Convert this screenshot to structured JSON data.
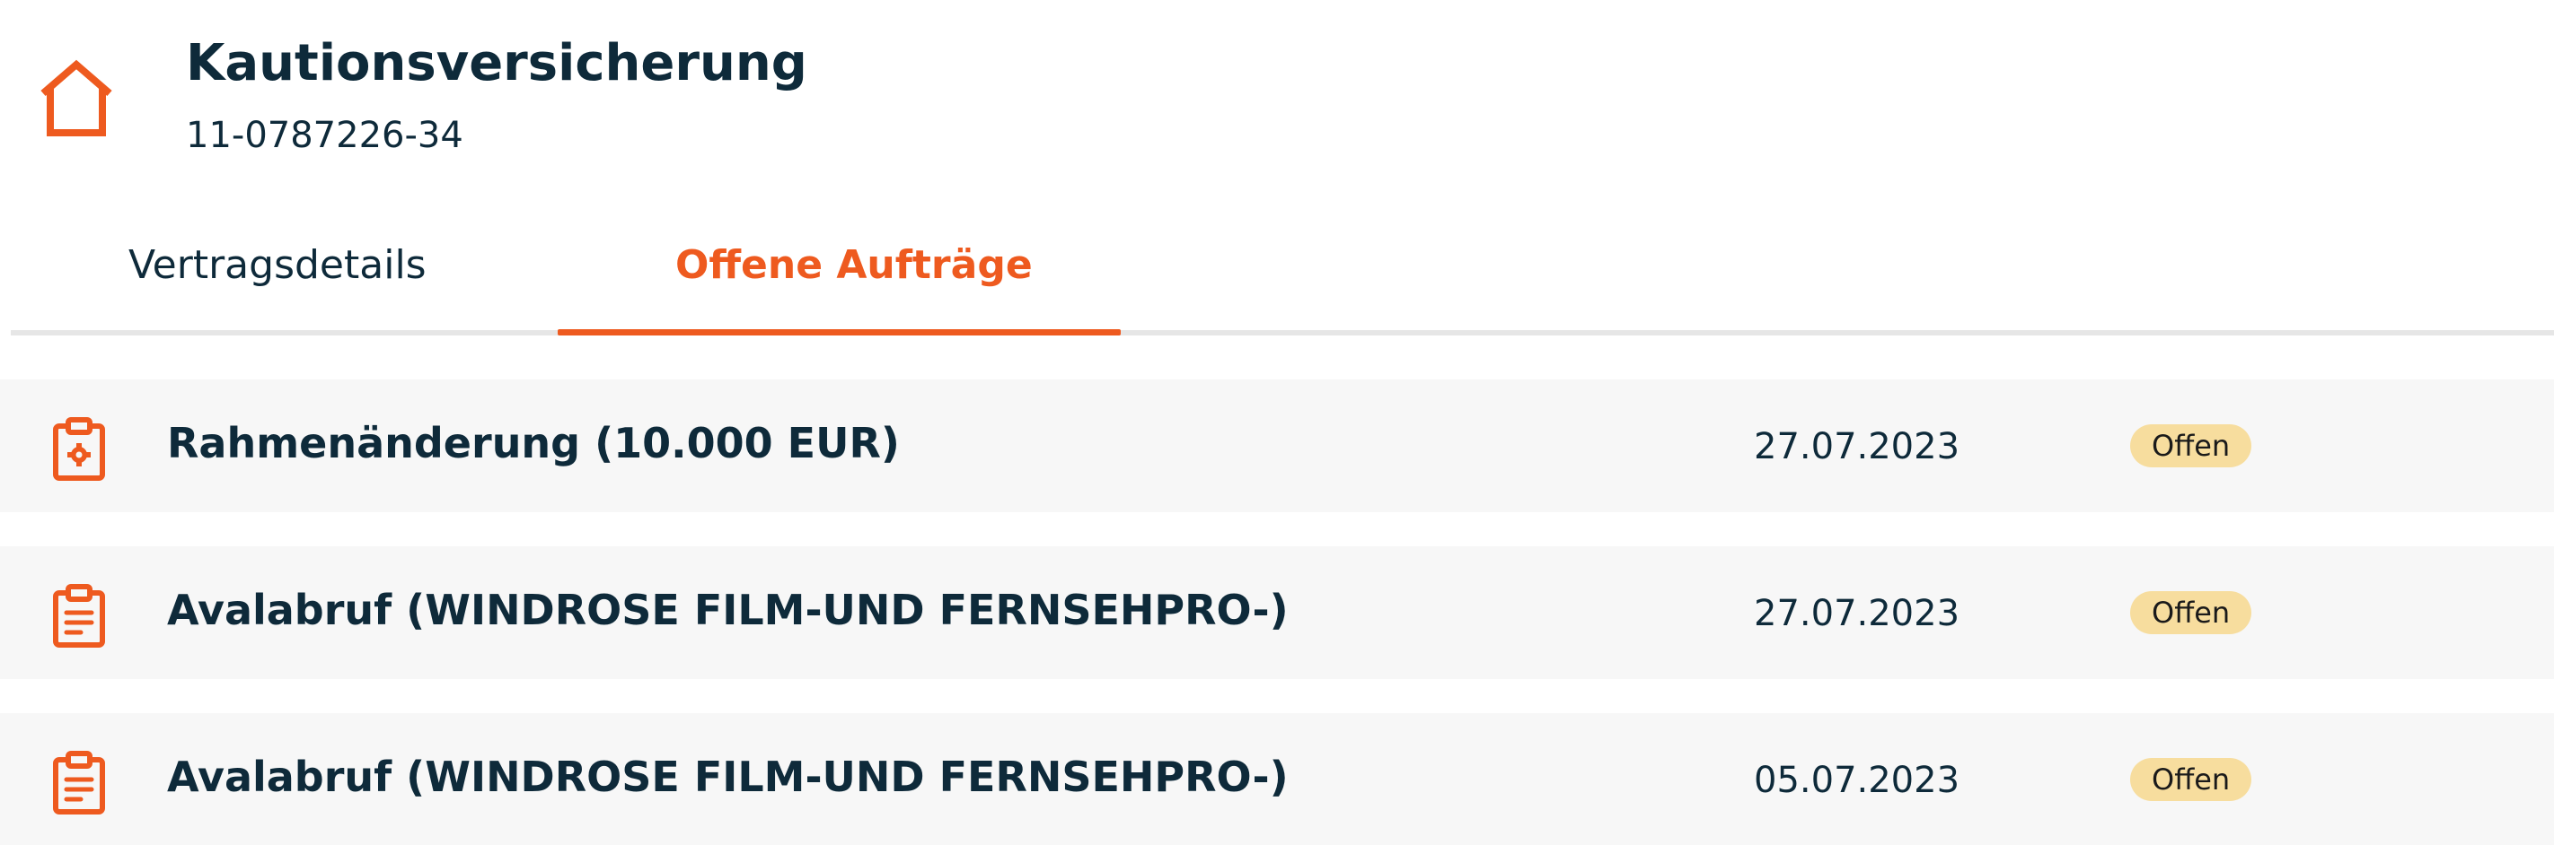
{
  "header": {
    "icon": "house-icon",
    "title": "Kautionsversicherung",
    "contract_number": "11-0787226-34"
  },
  "tabs": [
    {
      "label": "Vertragsdetails",
      "active": false
    },
    {
      "label": "Offene Aufträge",
      "active": true
    }
  ],
  "orders": [
    {
      "icon": "clipboard-gear-icon",
      "title": "Rahmenänderung (10.000 EUR)",
      "date": "27.07.2023",
      "status": "Offen"
    },
    {
      "icon": "clipboard-list-icon",
      "title": "Avalabruf (WINDROSE FILM-UND FERNSEHPRO-)",
      "date": "27.07.2023",
      "status": "Offen"
    },
    {
      "icon": "clipboard-list-icon",
      "title": "Avalabruf (WINDROSE FILM-UND FERNSEHPRO-)",
      "date": "05.07.2023",
      "status": "Offen"
    }
  ],
  "colors": {
    "accent": "#ee5a1f",
    "text": "#0e2a3a",
    "row_background": "#f7f7f7",
    "badge_background": "#f7dd9e"
  }
}
